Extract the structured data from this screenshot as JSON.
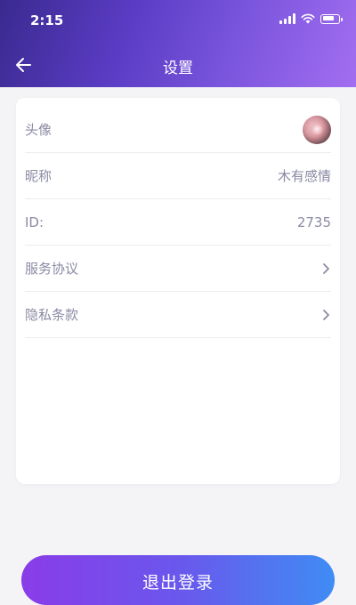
{
  "status_bar": {
    "time": "2:15"
  },
  "nav": {
    "title": "设置",
    "back_icon": "arrow-left-icon"
  },
  "settings": {
    "rows": [
      {
        "label": "头像",
        "value": "",
        "type": "avatar"
      },
      {
        "label": "昵称",
        "value": "木有感情",
        "type": "text"
      },
      {
        "label": "ID:",
        "value": "2735",
        "type": "text"
      },
      {
        "label": "服务协议",
        "value": "",
        "type": "link",
        "icon": "chevron-right-icon"
      },
      {
        "label": "隐私条款",
        "value": "",
        "type": "link",
        "icon": "chevron-right-icon"
      }
    ]
  },
  "logout": {
    "label": "退出登录"
  },
  "colors": {
    "header_gradient_start": "#3a2a8f",
    "header_gradient_end": "#a36ef0",
    "button_gradient_start": "#8a3ce8",
    "button_gradient_end": "#3f8cf4",
    "label_text": "#8a8aa4",
    "background": "#f4f4f6"
  }
}
